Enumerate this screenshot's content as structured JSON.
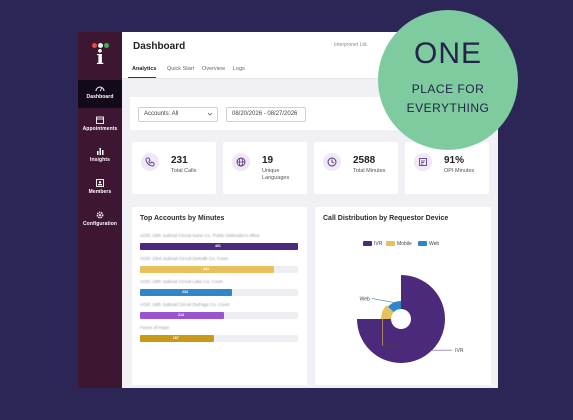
{
  "sidebar": {
    "items": [
      {
        "label": "Dashboard",
        "icon": "gauge-icon"
      },
      {
        "label": "Appointments",
        "icon": "calendar-icon"
      },
      {
        "label": "Insights",
        "icon": "bar-chart-icon"
      },
      {
        "label": "Members",
        "icon": "id-card-icon"
      },
      {
        "label": "Configuration",
        "icon": "gear-icon"
      }
    ]
  },
  "header": {
    "title": "Dashboard",
    "company": "Interpronet Ltd.",
    "tabs": [
      "Analytics",
      "Quick Start",
      "Overview",
      "Logs"
    ]
  },
  "filters": {
    "accounts": "Accounts: All",
    "date_range": "08/20/2026 - 08/27/2026"
  },
  "kpis": [
    {
      "value": "231",
      "label": "Total Calls",
      "icon": "phone-icon"
    },
    {
      "value": "19",
      "label": "Unique Languages",
      "icon": "globe-icon"
    },
    {
      "value": "2588",
      "label": "Total Minutes",
      "icon": "clock-icon"
    },
    {
      "value": "91%",
      "label": "OPI Minutes",
      "icon": "chart-icon"
    }
  ],
  "top_accounts": {
    "title": "Top Accounts by Minutes",
    "rows": [
      {
        "name": "AOIC 16th Judicial Circuit Kane Co. Public Defender's office",
        "value": 401,
        "color": "#4b2a7b"
      },
      {
        "name": "AOIC 23rd Judicial Circuit DeKalb Co. Court",
        "value": 341,
        "color": "#e8c15c"
      },
      {
        "name": "AOIC 19th Judicial Circuit Lake Co. Court",
        "value": 234,
        "color": "#2f86c9"
      },
      {
        "name": "AOIC 18th Judicial Circuit DuPage Co. Court",
        "value": 214,
        "color": "#9b53cf"
      },
      {
        "name": "Faces of Hope",
        "value": 187,
        "color": "#c99a17"
      }
    ],
    "max": 401
  },
  "call_distribution": {
    "title": "Call Distribution by Requestor Device",
    "legend": [
      "IVR",
      "Mobile",
      "Web"
    ],
    "labels": {
      "ivr": "IVR",
      "mobile": "Mobile",
      "web": "Web"
    }
  },
  "chart_data": {
    "type": "pie",
    "title": "Call Distribution by Requestor Device",
    "categories": [
      "IVR",
      "Mobile",
      "Web"
    ],
    "values": [
      75,
      12,
      13
    ],
    "colors": [
      "#4b2a7b",
      "#e8c15c",
      "#2f86c9"
    ],
    "legend": "top"
  },
  "badge": {
    "line1": "ONE",
    "line2": "PLACE FOR",
    "line3": "EVERYTHING"
  },
  "colors": {
    "background": "#2c2657",
    "sidebar": "#3d1732",
    "badge": "#7dcb9e",
    "accent": "#4b2a7b"
  }
}
